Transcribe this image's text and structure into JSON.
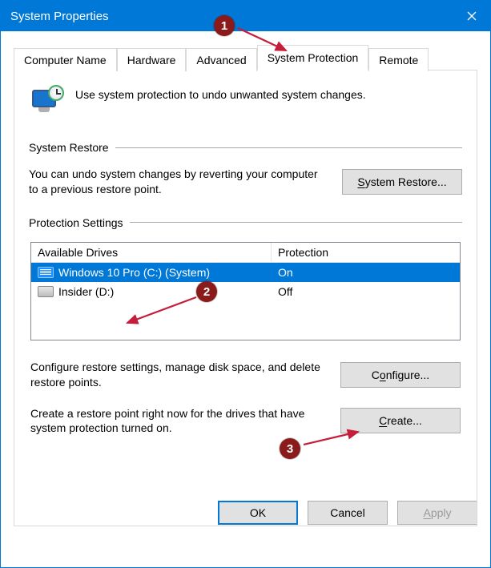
{
  "window": {
    "title": "System Properties"
  },
  "tabs": [
    {
      "label": "Computer Name"
    },
    {
      "label": "Hardware"
    },
    {
      "label": "Advanced"
    },
    {
      "label": "System Protection",
      "active": true
    },
    {
      "label": "Remote"
    }
  ],
  "intro": "Use system protection to undo unwanted system changes.",
  "system_restore": {
    "legend": "System Restore",
    "text": "You can undo system changes by reverting your computer to a previous restore point.",
    "button": "System Restore..."
  },
  "protection": {
    "legend": "Protection Settings",
    "columns": {
      "a": "Available Drives",
      "b": "Protection"
    },
    "drives": [
      {
        "name": "Windows 10 Pro (C:) (System)",
        "status": "On",
        "selected": true,
        "kind": "system"
      },
      {
        "name": "Insider (D:)",
        "status": "Off",
        "selected": false,
        "kind": "hdd"
      }
    ],
    "configure": {
      "text": "Configure restore settings, manage disk space, and delete restore points.",
      "button": "Configure..."
    },
    "create": {
      "text": "Create a restore point right now for the drives that have system protection turned on.",
      "button": "Create..."
    }
  },
  "footer": {
    "ok": "OK",
    "cancel": "Cancel",
    "apply": "Apply"
  },
  "annotations": {
    "m1": "1",
    "m2": "2",
    "m3": "3"
  }
}
